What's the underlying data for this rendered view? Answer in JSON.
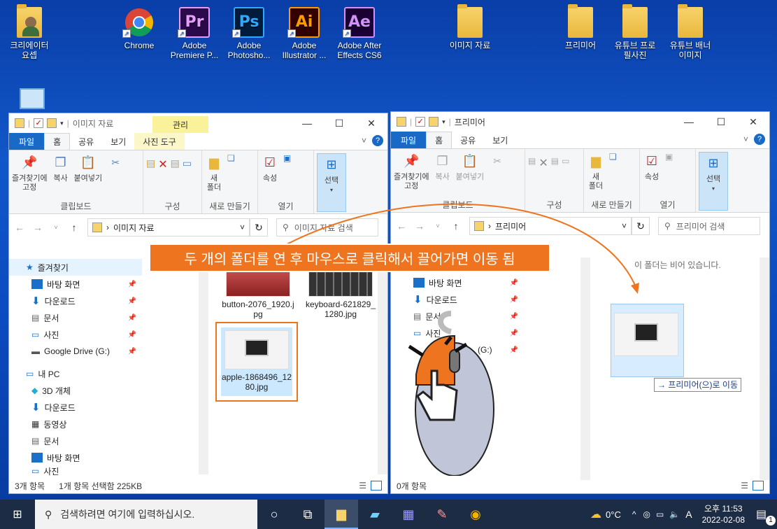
{
  "desktop": {
    "icons": [
      {
        "label": "크리에이터\n요셉",
        "kind": "user"
      },
      {
        "label": "Chrome",
        "kind": "chrome"
      },
      {
        "label": "Adobe Premiere P...",
        "kind": "pr",
        "abbr": "Pr",
        "color": "#2a0a4a",
        "fg": "#e79cff"
      },
      {
        "label": "Adobe Photosho...",
        "kind": "ps",
        "abbr": "Ps",
        "color": "#001c3a",
        "fg": "#31a8ff"
      },
      {
        "label": "Adobe Illustrator ...",
        "kind": "ai",
        "abbr": "Ai",
        "color": "#330000",
        "fg": "#ff9a00"
      },
      {
        "label": "Adobe After Effects CS6",
        "kind": "ae",
        "abbr": "Ae",
        "color": "#1a0033",
        "fg": "#d291ff"
      },
      {
        "label": "이미지 자료",
        "kind": "folder"
      },
      {
        "label": "프리미어",
        "kind": "folder"
      },
      {
        "label": "유튜브 프로필사진",
        "kind": "folder"
      },
      {
        "label": "유튜브 배너이미지",
        "kind": "folder"
      }
    ]
  },
  "left_window": {
    "title": "이미지 자료",
    "context_tab": "관리",
    "tabs": [
      "파일",
      "홈",
      "공유",
      "보기",
      "사진 도구"
    ],
    "ribbon": {
      "clipboard": {
        "pin": "즐겨찾기에\n고정",
        "copy": "복사",
        "paste": "붙여넣기",
        "label": "클립보드"
      },
      "organize": {
        "label": "구성"
      },
      "new": {
        "new_folder": "새\n폴더",
        "label": "새로 만들기"
      },
      "open": {
        "props": "속성",
        "label": "열기"
      },
      "select": {
        "select": "선택"
      }
    },
    "address": "이미지 자료",
    "search_placeholder": "이미지 자료 검색",
    "nav": [
      "즐겨찾기",
      "바탕 화면",
      "다운로드",
      "문서",
      "사진",
      "Google Drive (G:)",
      "내 PC",
      "3D 개체",
      "다운로드",
      "동영상",
      "문서",
      "바탕 화면",
      "사진"
    ],
    "files": [
      {
        "name": "button-2076_1920.jpg"
      },
      {
        "name": "keyboard-621829_1280.jpg"
      },
      {
        "name": "apple-1868496_1280.jpg"
      }
    ],
    "status_count": "3개 항목",
    "status_selected": "1개 항목 선택함 225KB"
  },
  "right_window": {
    "title": "프리미어",
    "tabs": [
      "파일",
      "홈",
      "공유",
      "보기"
    ],
    "ribbon": {
      "clipboard": {
        "pin": "즐겨찾기에\n고정",
        "copy": "복사",
        "paste": "붙여넣기",
        "label": "클립보드"
      },
      "organize": {
        "label": "구성"
      },
      "new": {
        "new_folder": "새\n폴더",
        "label": "새로 만들기"
      },
      "open": {
        "props": "속성",
        "label": "열기"
      },
      "select": {
        "select": "선택"
      }
    },
    "address": "프리미어",
    "search_placeholder": "프리미어 검색",
    "empty_message": "이 폴더는 비어 있습니다.",
    "nav": [
      "바탕 화면",
      "다운로드",
      "문서",
      "사진",
      "(G:)"
    ],
    "drag_tooltip": "→ 프리미어(으)로 이동",
    "status_count": "0개 항목"
  },
  "caption": "두 개의 폴더를 연 후 마우스로 클릭해서 끌어가면 이동 됨",
  "taskbar": {
    "search_placeholder": "검색하려면 여기에 입력하십시오.",
    "weather": "0°C",
    "ime": "A",
    "time": "오후 11:53",
    "date": "2022-02-08",
    "notification_count": "1"
  },
  "colors": {
    "accent": "#1969c7",
    "caption_bg": "#ee7420",
    "select_border": "#ee7420",
    "taskbar": "#1d2c45"
  }
}
